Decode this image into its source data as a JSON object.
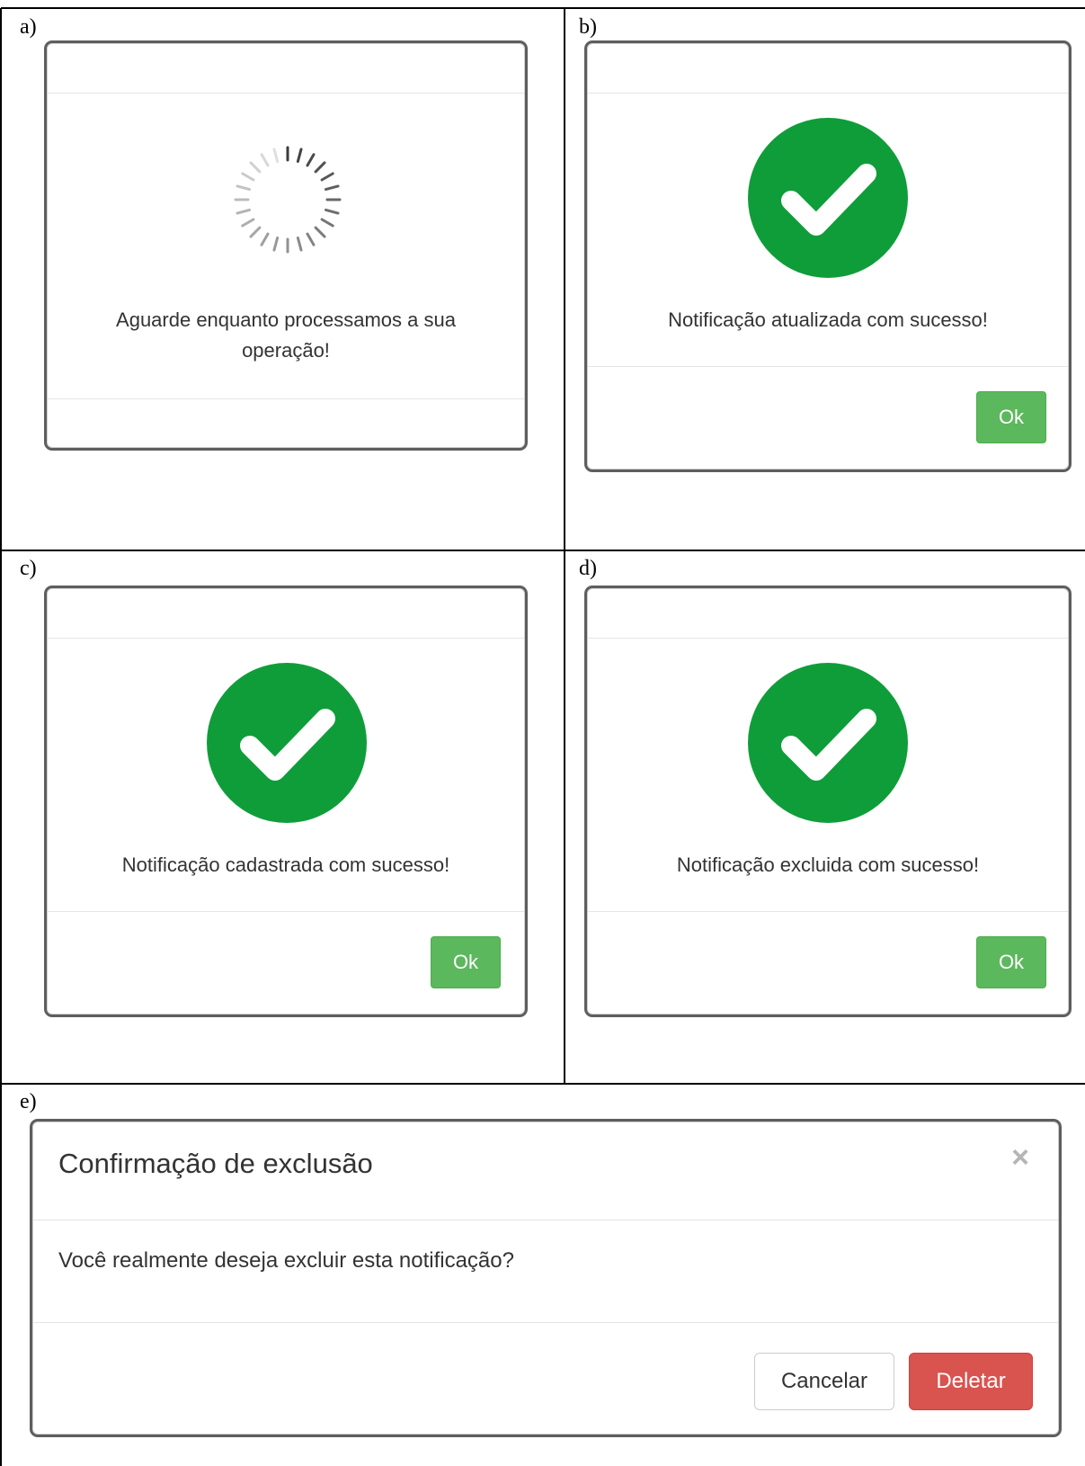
{
  "panels": {
    "a": {
      "label": "a)",
      "message": "Aguarde enquanto processamos a sua operação!"
    },
    "b": {
      "label": "b)",
      "message": "Notificação atualizada com sucesso!",
      "button": "Ok"
    },
    "c": {
      "label": "c)",
      "message": "Notificação cadastrada com sucesso!",
      "button": "Ok"
    },
    "d": {
      "label": "d)",
      "message": "Notificação excluida com sucesso!",
      "button": "Ok"
    },
    "e": {
      "label": "e)",
      "title": "Confirmação de exclusão",
      "close_icon": "×",
      "body": "Você realmente deseja excluir esta notificação?",
      "cancel": "Cancelar",
      "delete": "Deletar"
    }
  },
  "icons": {
    "spinner": "spinner-icon",
    "success": "check-circle-icon",
    "close": "close-icon"
  },
  "colors": {
    "success_green": "#0f9d3a",
    "ok_button": "#5cb85c",
    "delete_button": "#d9534f"
  }
}
